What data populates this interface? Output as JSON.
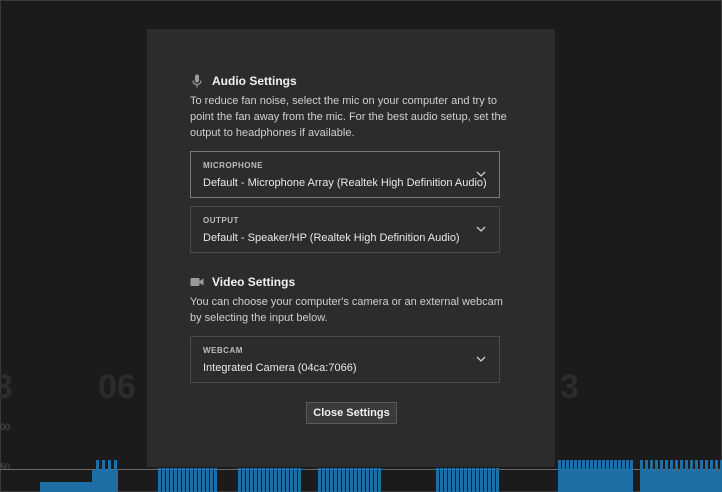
{
  "background": {
    "big_numbers": [
      "3",
      "06",
      "3"
    ],
    "tick_labels": [
      "00",
      "50"
    ],
    "bar_color": "#1d6fa5"
  },
  "audio": {
    "title": "Audio Settings",
    "icon": "microphone-icon",
    "description": "To reduce fan noise, select the mic on your computer and try to point the fan away from the mic. For the best audio setup, set the output to headphones if available.",
    "microphone": {
      "label": "MICROPHONE",
      "value": "Default - Microphone Array (Realtek High Definition Audio)"
    },
    "output": {
      "label": "OUTPUT",
      "value": "Default - Speaker/HP (Realtek High Definition Audio)"
    }
  },
  "video": {
    "title": "Video Settings",
    "icon": "camera-icon",
    "description": "You can choose your computer's camera or an external webcam by selecting the input below.",
    "webcam": {
      "label": "WEBCAM",
      "value": "Integrated Camera (04ca:7066)"
    }
  },
  "close_button": "Close Settings"
}
